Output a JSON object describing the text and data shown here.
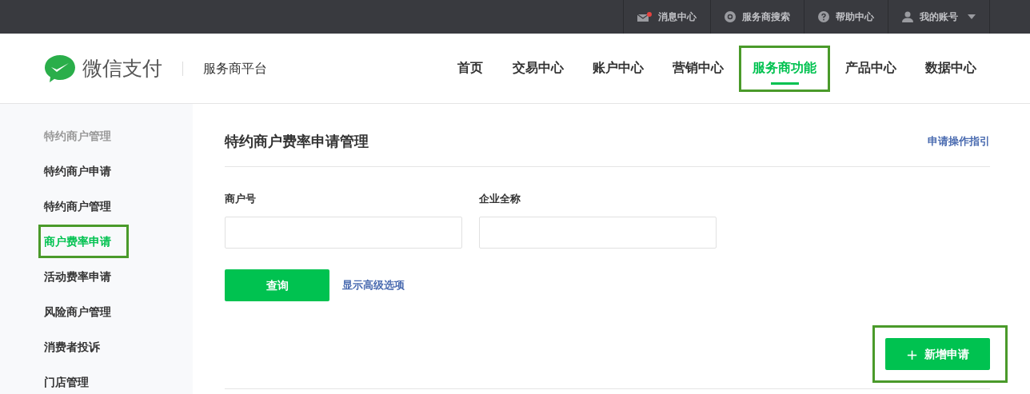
{
  "top_bar": {
    "items": [
      {
        "kind": "message",
        "label": "消息中心",
        "unread": true
      },
      {
        "kind": "search",
        "label": "服务商搜索"
      },
      {
        "kind": "help",
        "label": "帮助中心"
      },
      {
        "kind": "account",
        "label": "我的账号"
      }
    ]
  },
  "header": {
    "logo_text": "微信支付",
    "platform": "服务商平台",
    "nav": [
      {
        "label": "首页",
        "selected": false,
        "highlighted": false
      },
      {
        "label": "交易中心",
        "selected": false,
        "highlighted": false
      },
      {
        "label": "账户中心",
        "selected": false,
        "highlighted": false
      },
      {
        "label": "营销中心",
        "selected": false,
        "highlighted": false
      },
      {
        "label": "服务商功能",
        "selected": true,
        "highlighted": true
      },
      {
        "label": "产品中心",
        "selected": false,
        "highlighted": false
      },
      {
        "label": "数据中心",
        "selected": false,
        "highlighted": false
      }
    ]
  },
  "sidebar": {
    "heading": "特约商户管理",
    "items": [
      {
        "label": "特约商户申请",
        "selected": false,
        "highlighted": false
      },
      {
        "label": "特约商户管理",
        "selected": false,
        "highlighted": false
      },
      {
        "label": "商户费率申请",
        "selected": true,
        "highlighted": true
      },
      {
        "label": "活动费率申请",
        "selected": false,
        "highlighted": false
      },
      {
        "label": "风险商户管理",
        "selected": false,
        "highlighted": false
      },
      {
        "label": "消费者投诉",
        "selected": false,
        "highlighted": false
      },
      {
        "label": "门店管理",
        "selected": false,
        "highlighted": false
      }
    ]
  },
  "main": {
    "title": "特约商户费率申请管理",
    "guide_link": "申请操作指引",
    "fields": [
      {
        "label": "商户号"
      },
      {
        "label": "企业全称"
      }
    ],
    "query_button": "查询",
    "advanced_link": "显示高级选项",
    "add_button": {
      "icon": "+",
      "label": "新增申请",
      "highlighted": true
    }
  }
}
